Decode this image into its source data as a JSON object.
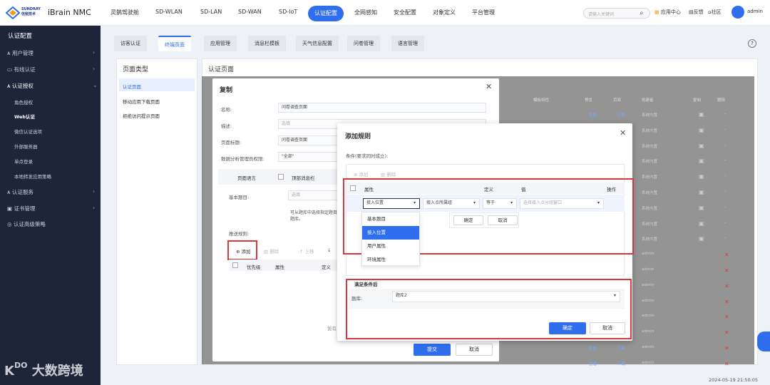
{
  "brand": {
    "logo_line1": "SUNDRAY",
    "logo_line2": "信锐技术",
    "product": "iBrain NMC"
  },
  "topnav": [
    "灵鹊驾驶舱",
    "SD-WLAN",
    "SD-LAN",
    "SD-WAN",
    "SD-IoT",
    "认证配置",
    "全网感知",
    "安全配置",
    "对象定义",
    "平台管理"
  ],
  "topnav_active": "认证配置",
  "search": {
    "placeholder": "请输入关键词"
  },
  "top_right": {
    "app_center": "应用中心",
    "feedback": "反馈",
    "community": "社区",
    "user": "admin"
  },
  "sidebar": {
    "title": "认证配置",
    "items": [
      {
        "label": "用户管理"
      },
      {
        "label": "有线认证"
      },
      {
        "label": "认证授权"
      },
      {
        "label": "认证服务"
      },
      {
        "label": "证书管理"
      },
      {
        "label": "认证高级策略"
      }
    ],
    "subitems": [
      {
        "label": "角色授权"
      },
      {
        "label": "Web认证"
      },
      {
        "label": "微信认证选项"
      },
      {
        "label": "外部服务器"
      },
      {
        "label": "单点登录"
      },
      {
        "label": "本地转发应用策略"
      }
    ],
    "active_sub": "Web认证",
    "watermark": "大数跨境"
  },
  "tabs": [
    "访客认证",
    "终端页面",
    "应用管理",
    "消息栏模板",
    "天气信息配置",
    "问卷管理",
    "语言管理"
  ],
  "active_tab": "终端页面",
  "page_types": {
    "header": "页面类型",
    "items": [
      "认证页面",
      "移动应用下载页面",
      "拒绝访问提示页面"
    ],
    "active": "认证页面"
  },
  "main": {
    "header": "认证页面"
  },
  "bg_table": {
    "headers": [
      "模板特性",
      "预览",
      "页面",
      "创建者",
      "复制",
      "删除"
    ],
    "rows": [
      {
        "preview": "查看",
        "page": "下载",
        "creator": "系统内置",
        "delete": "-"
      },
      {
        "preview": "",
        "page": "",
        "creator": "系统内置",
        "delete": "-"
      },
      {
        "preview": "",
        "page": "",
        "creator": "系统内置",
        "delete": "-"
      },
      {
        "preview": "",
        "page": "",
        "creator": "系统内置",
        "delete": "-"
      },
      {
        "preview": "",
        "page": "",
        "creator": "系统内置",
        "delete": "-"
      },
      {
        "preview": "",
        "page": "",
        "creator": "系统内置",
        "delete": "-"
      },
      {
        "preview": "",
        "page": "",
        "creator": "系统内置",
        "delete": "-"
      },
      {
        "preview": "",
        "page": "",
        "creator": "系统内置",
        "delete": "-"
      },
      {
        "preview": "",
        "page": "",
        "creator": "系统内置",
        "delete": "-"
      },
      {
        "preview": "",
        "page": "",
        "creator": "admin",
        "delete": "✕"
      },
      {
        "preview": "",
        "page": "",
        "creator": "admin",
        "delete": "✕"
      },
      {
        "preview": "",
        "page": "",
        "creator": "admin",
        "delete": "✕"
      },
      {
        "preview": "",
        "page": "",
        "creator": "admin",
        "delete": "✕"
      },
      {
        "preview": "",
        "page": "",
        "creator": "admin",
        "delete": "✕"
      },
      {
        "preview": "",
        "page": "",
        "creator": "admin",
        "delete": "✕"
      },
      {
        "preview": "查看",
        "page": "下载",
        "creator": "admin",
        "delete": "✕"
      },
      {
        "preview": "查看",
        "page": "下载",
        "creator": "admin",
        "delete": "✕"
      }
    ]
  },
  "copy_dialog": {
    "title": "复制",
    "name_label": "名称:",
    "name_value": "问卷调查页面",
    "desc_label": "描述:",
    "desc_placeholder": "选填",
    "pagetitle_label": "页面标题:",
    "pagetitle_value": "问卷调查页面",
    "perm_label": "数据分析管理员权限:",
    "perm_value": "\"全部\"",
    "lang_tab": "页面语言",
    "msgbar_tab": "顶部消息栏",
    "basic_q_label": "基本题目:",
    "basic_q_placeholder": "选填",
    "hint": "可从题库中选择指定题目",
    "hint2": "题库。",
    "rule_label": "推送规则:",
    "add": "添加",
    "delete": "删除",
    "up": "上移",
    "col_priority": "优先级",
    "col_attr": "属性",
    "col_def": "定义",
    "empty": "暂有",
    "submit": "提交",
    "cancel": "取消"
  },
  "rule_dialog": {
    "title": "添加规则",
    "cond_label": "条件(要求同时成立):",
    "add": "添加",
    "delete": "删除",
    "headers": {
      "attr": "属性",
      "def": "定义",
      "value": "值",
      "op": "操作"
    },
    "row": {
      "attr": "接入位置",
      "sub": "接入点所属组",
      "def": "等于",
      "value_placeholder": "选择接入点分组窗口"
    },
    "attr_options": [
      "基本题目",
      "接入位置",
      "用户属性",
      "环境属性"
    ],
    "attr_selected": "接入位置",
    "mini_ok": "确定",
    "mini_cancel": "取消",
    "after_label": "满足条件后",
    "bank_label": "题库:",
    "bank_value": "题库2",
    "ok": "确定",
    "cancel": "取消"
  },
  "timestamp": "2024-05-19 21:50:05",
  "colors": {
    "accent": "#2f6fed",
    "sidebar": "#1e2538",
    "highlight_box": "#d9363e"
  }
}
